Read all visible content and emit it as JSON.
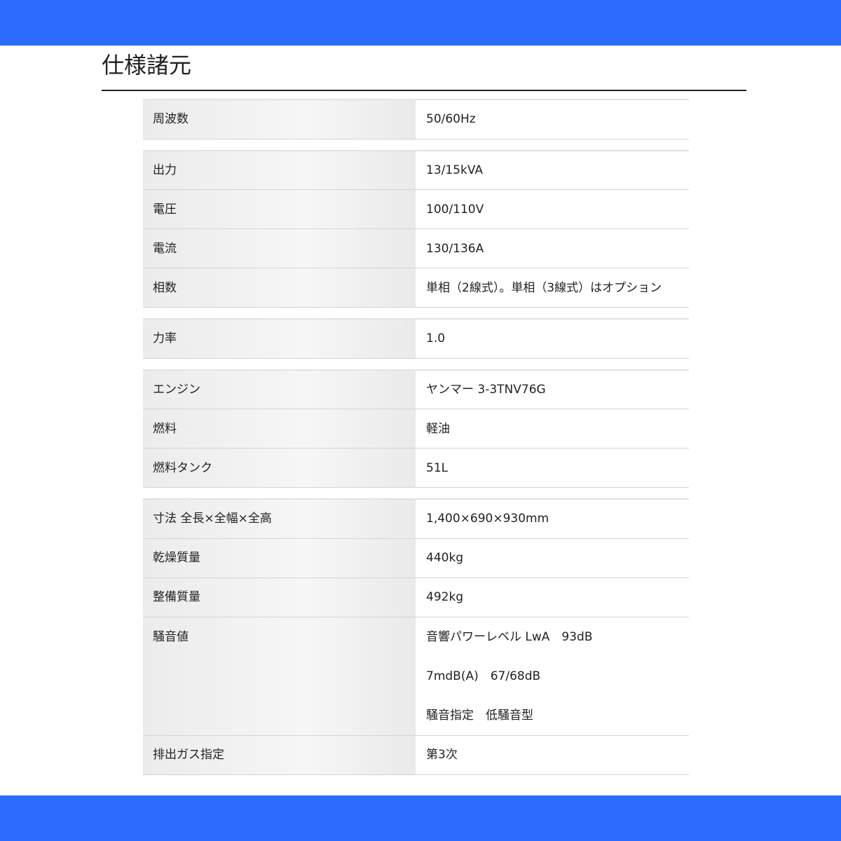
{
  "page": {
    "title": "仕様諸元"
  },
  "spec_groups": [
    [
      {
        "label": "周波数",
        "value": "50/60Hz"
      }
    ],
    [
      {
        "label": "出力",
        "value": "13/15kVA"
      },
      {
        "label": "電圧",
        "value": "100/110V"
      },
      {
        "label": "電流",
        "value": "130/136A"
      },
      {
        "label": "相数",
        "value": "単相（2線式）。単相（3線式）はオプション"
      }
    ],
    [
      {
        "label": "力率",
        "value": "1.0"
      }
    ],
    [
      {
        "label": "エンジン",
        "value": "ヤンマー 3-3TNV76G"
      },
      {
        "label": "燃料",
        "value": "軽油"
      },
      {
        "label": "燃料タンク",
        "value": "51L"
      }
    ],
    [
      {
        "label": "寸法 全長×全幅×全高",
        "value": "1,400×690×930mm"
      },
      {
        "label": "乾燥質量",
        "value": "440kg"
      },
      {
        "label": "整備質量",
        "value": "492kg"
      },
      {
        "label": "騒音値",
        "values": [
          "音響パワーレベル LwA　93dB",
          "7mdB(A)　67/68dB",
          "騒音指定　低騒音型"
        ]
      },
      {
        "label": "排出ガス指定",
        "value": "第3次"
      }
    ]
  ],
  "colors": {
    "band": "#2b6cff",
    "label_bg": "#ececec",
    "rule": "#222222"
  }
}
